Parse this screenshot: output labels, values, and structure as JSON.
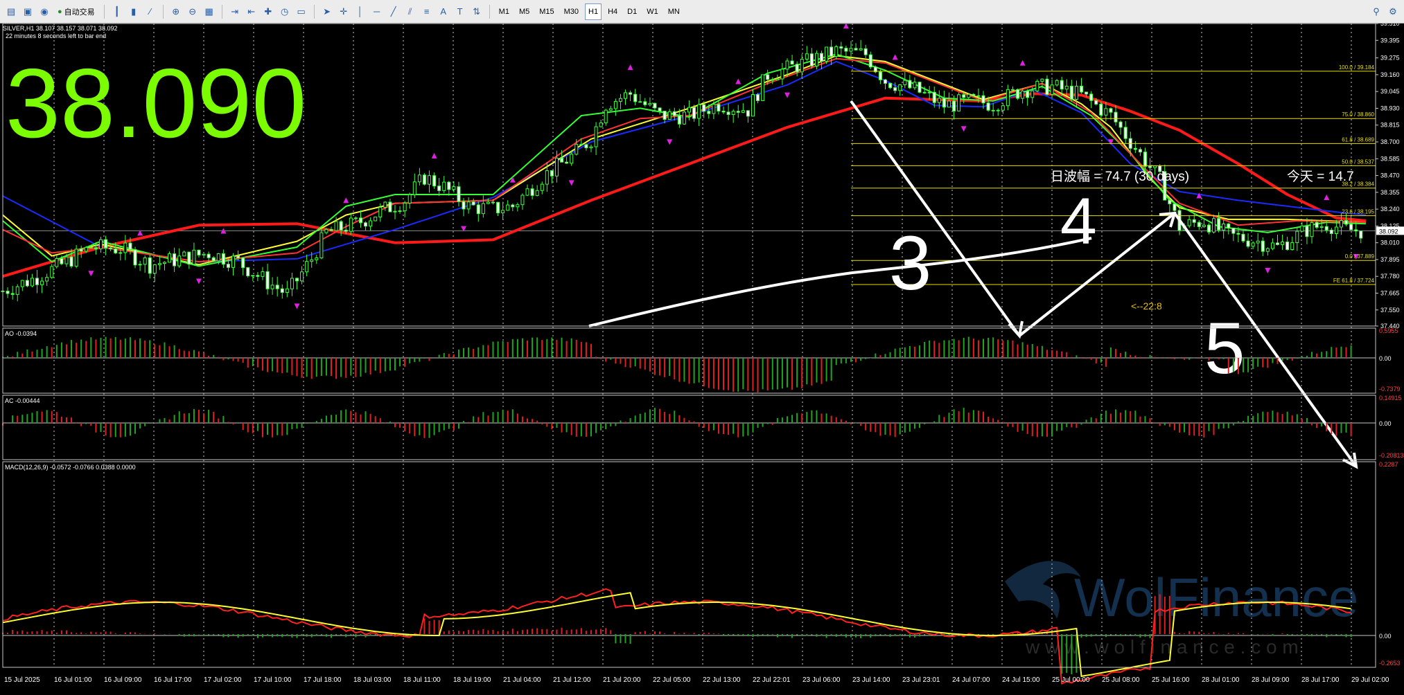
{
  "toolbar": {
    "auto_trading_label": "自动交易",
    "timeframes": [
      "M1",
      "M5",
      "M15",
      "M30",
      "H1",
      "H4",
      "D1",
      "W1",
      "MN"
    ],
    "active_timeframe": "H1"
  },
  "chart_header": {
    "symbol_line": "SILVER,H1  38.107 38.157 38.071 38.092",
    "countdown": "22 minutes 8 seconds left to bar end"
  },
  "big_price": "38.090",
  "chart_data": [
    {
      "type": "candlestick",
      "symbol": "SILVER",
      "timeframe": "H1",
      "ohlc_header": [
        38.107,
        38.157,
        38.071,
        38.092
      ],
      "current_price": "38.092",
      "ylim": [
        37.44,
        39.51
      ],
      "y_ticks": [
        "39.510",
        "39.395",
        "39.275",
        "39.160",
        "39.045",
        "38.930",
        "38.815",
        "38.700",
        "38.585",
        "38.470",
        "38.355",
        "38.240",
        "38.125",
        "38.010",
        "37.895",
        "37.780",
        "37.665",
        "37.550",
        "37.440"
      ],
      "x_ticks": [
        "15 Jul 2025",
        "16 Jul 01:00",
        "16 Jul 09:00",
        "16 Jul 17:00",
        "17 Jul 02:00",
        "17 Jul 10:00",
        "17 Jul 18:00",
        "18 Jul 03:00",
        "18 Jul 11:00",
        "18 Jul 19:00",
        "21 Jul 04:00",
        "21 Jul 12:00",
        "21 Jul 20:00",
        "22 Jul 05:00",
        "22 Jul 13:00",
        "22 Jul 22:01",
        "23 Jul 06:00",
        "23 Jul 14:00",
        "23 Jul 23:01",
        "24 Jul 07:00",
        "24 Jul 15:00",
        "25 Jul 00:00",
        "25 Jul 08:00",
        "25 Jul 16:00",
        "28 Jul 01:00",
        "28 Jul 09:00",
        "28 Jul 17:00",
        "29 Jul 02:00"
      ],
      "close_path": [
        [
          0,
          37.68
        ],
        [
          6,
          37.76
        ],
        [
          12,
          37.86
        ],
        [
          18,
          37.98
        ],
        [
          24,
          37.97
        ],
        [
          30,
          37.86
        ],
        [
          36,
          37.9
        ],
        [
          42,
          37.94
        ],
        [
          48,
          37.88
        ],
        [
          54,
          37.74
        ],
        [
          58,
          37.66
        ],
        [
          63,
          37.9
        ],
        [
          66,
          38.08
        ],
        [
          72,
          38.14
        ],
        [
          78,
          38.24
        ],
        [
          82,
          38.3
        ],
        [
          86,
          38.46
        ],
        [
          90,
          38.39
        ],
        [
          95,
          38.26
        ],
        [
          100,
          38.24
        ],
        [
          104,
          38.26
        ],
        [
          110,
          38.46
        ],
        [
          116,
          38.6
        ],
        [
          120,
          38.72
        ],
        [
          123,
          38.96
        ],
        [
          128,
          39.03
        ],
        [
          134,
          38.88
        ],
        [
          140,
          38.88
        ],
        [
          146,
          38.96
        ],
        [
          152,
          38.92
        ],
        [
          156,
          39.16
        ],
        [
          160,
          39.2
        ],
        [
          166,
          39.27
        ],
        [
          170,
          39.32
        ],
        [
          176,
          39.3
        ],
        [
          180,
          39.12
        ],
        [
          186,
          39.06
        ],
        [
          192,
          38.95
        ],
        [
          198,
          38.98
        ],
        [
          202,
          38.96
        ],
        [
          208,
          39.06
        ],
        [
          214,
          39.08
        ],
        [
          220,
          39.02
        ],
        [
          226,
          38.88
        ],
        [
          231,
          38.66
        ],
        [
          236,
          38.44
        ],
        [
          240,
          38.12
        ],
        [
          245,
          38.16
        ],
        [
          250,
          38.06
        ],
        [
          256,
          38.02
        ],
        [
          260,
          37.98
        ],
        [
          266,
          38.1
        ],
        [
          270,
          38.14
        ],
        [
          274,
          38.1
        ],
        [
          278,
          38.09
        ]
      ],
      "moving_averages": [
        {
          "name": "slow",
          "color": "#ff1a1a",
          "path": [
            [
              0,
              37.78
            ],
            [
              20,
              37.98
            ],
            [
              40,
              38.13
            ],
            [
              60,
              38.14
            ],
            [
              80,
              38.01
            ],
            [
              100,
              38.03
            ],
            [
              120,
              38.3
            ],
            [
              140,
              38.55
            ],
            [
              160,
              38.8
            ],
            [
              180,
              39.0
            ],
            [
              200,
              38.98
            ],
            [
              210,
              39.03
            ],
            [
              220,
              39.02
            ],
            [
              230,
              38.91
            ],
            [
              240,
              38.78
            ],
            [
              252,
              38.55
            ],
            [
              262,
              38.34
            ],
            [
              272,
              38.18
            ],
            [
              278,
              38.16
            ]
          ]
        },
        {
          "name": "blue",
          "color": "#1a2bff",
          "path": [
            [
              0,
              38.33
            ],
            [
              20,
              37.98
            ],
            [
              40,
              37.88
            ],
            [
              60,
              37.9
            ],
            [
              80,
              38.1
            ],
            [
              100,
              38.32
            ],
            [
              120,
              38.7
            ],
            [
              140,
              38.88
            ],
            [
              160,
              39.09
            ],
            [
              170,
              39.25
            ],
            [
              180,
              39.12
            ],
            [
              190,
              38.95
            ],
            [
              200,
              38.94
            ],
            [
              210,
              39.06
            ],
            [
              220,
              38.9
            ],
            [
              230,
              38.55
            ],
            [
              240,
              38.36
            ],
            [
              252,
              38.3
            ],
            [
              262,
              38.26
            ],
            [
              272,
              38.22
            ],
            [
              278,
              38.2
            ]
          ]
        },
        {
          "name": "yellow",
          "color": "#ffff33",
          "path": [
            [
              0,
              38.2
            ],
            [
              10,
              37.92
            ],
            [
              20,
              38.0
            ],
            [
              40,
              37.86
            ],
            [
              60,
              38.02
            ],
            [
              70,
              38.2
            ],
            [
              80,
              38.28
            ],
            [
              100,
              38.3
            ],
            [
              120,
              38.72
            ],
            [
              140,
              38.93
            ],
            [
              160,
              39.16
            ],
            [
              170,
              39.29
            ],
            [
              180,
              39.25
            ],
            [
              200,
              38.99
            ],
            [
              212,
              39.1
            ],
            [
              220,
              38.96
            ],
            [
              226,
              38.8
            ],
            [
              234,
              38.45
            ],
            [
              240,
              38.25
            ],
            [
              250,
              38.17
            ],
            [
              262,
              38.17
            ],
            [
              278,
              38.15
            ]
          ]
        },
        {
          "name": "green",
          "color": "#33ff33",
          "path": [
            [
              0,
              38.16
            ],
            [
              10,
              37.88
            ],
            [
              20,
              38.02
            ],
            [
              40,
              37.85
            ],
            [
              60,
              37.98
            ],
            [
              70,
              38.26
            ],
            [
              80,
              38.34
            ],
            [
              100,
              38.34
            ],
            [
              118,
              38.88
            ],
            [
              130,
              38.93
            ],
            [
              140,
              38.87
            ],
            [
              156,
              39.17
            ],
            [
              170,
              39.3
            ],
            [
              180,
              39.19
            ],
            [
              192,
              39.0
            ],
            [
              202,
              38.98
            ],
            [
              212,
              39.08
            ],
            [
              222,
              38.88
            ],
            [
              230,
              38.62
            ],
            [
              238,
              38.3
            ],
            [
              248,
              38.12
            ],
            [
              258,
              38.08
            ],
            [
              270,
              38.15
            ],
            [
              278,
              38.14
            ]
          ]
        },
        {
          "name": "red-fast",
          "color": "#ff3333",
          "path": [
            [
              0,
              38.1
            ],
            [
              10,
              37.94
            ],
            [
              20,
              37.98
            ],
            [
              40,
              37.88
            ],
            [
              60,
              37.94
            ],
            [
              70,
              38.12
            ],
            [
              80,
              38.28
            ],
            [
              100,
              38.3
            ],
            [
              118,
              38.72
            ],
            [
              130,
              38.86
            ],
            [
              140,
              38.88
            ],
            [
              156,
              39.1
            ],
            [
              170,
              39.27
            ],
            [
              180,
              39.24
            ],
            [
              200,
              38.98
            ],
            [
              212,
              39.1
            ],
            [
              222,
              38.9
            ],
            [
              232,
              38.55
            ],
            [
              240,
              38.28
            ],
            [
              252,
              38.13
            ],
            [
              264,
              38.16
            ],
            [
              278,
              38.15
            ]
          ]
        }
      ],
      "fibonacci_levels": [
        {
          "label": "100.0 / 39.184",
          "value": 39.184
        },
        {
          "label": "75.0 / 38.860",
          "value": 38.86
        },
        {
          "label": "61.8 / 38.689",
          "value": 38.689
        },
        {
          "label": "50.0 / 38.537",
          "value": 38.537
        },
        {
          "label": "38.2 / 38.384",
          "value": 38.384
        },
        {
          "label": "23.6 / 38.195",
          "value": 38.195
        },
        {
          "label": "0.0 / 37.889",
          "value": 37.889
        },
        {
          "label": "FE 61.8 / 37.724",
          "value": 37.724
        }
      ],
      "annotations": {
        "daily_range": "日波幅 = 74.7  (30 days)",
        "today_range": "今天 = 14.7",
        "countdown_tag": "<--22:8",
        "wave_labels": [
          "3",
          "4",
          "5"
        ]
      }
    },
    {
      "type": "histogram",
      "name": "AO",
      "title": "AO -0.0394",
      "ylim": [
        -0.7379,
        0.5955
      ],
      "y_ticks": [
        "0.5955",
        "0.00",
        "-0.7379"
      ]
    },
    {
      "type": "histogram",
      "name": "AC",
      "title": "AC -0.00444",
      "ylim": [
        -0.20813,
        0.14915
      ],
      "y_ticks": [
        "0.14915",
        "0.00",
        "-0.20813"
      ]
    },
    {
      "type": "histogram",
      "name": "MACD",
      "title": "MACD(12,26,9) -0.0572 -0.0766 0.0388 0.0000",
      "ylim": [
        -0.2653,
        0.2287
      ],
      "y_ticks": [
        "0.2287",
        "0.00",
        "-0.2653"
      ]
    }
  ],
  "watermark": {
    "brand": "WolFinance",
    "url": "w w w . w o l f i n a n c e . c o m"
  }
}
